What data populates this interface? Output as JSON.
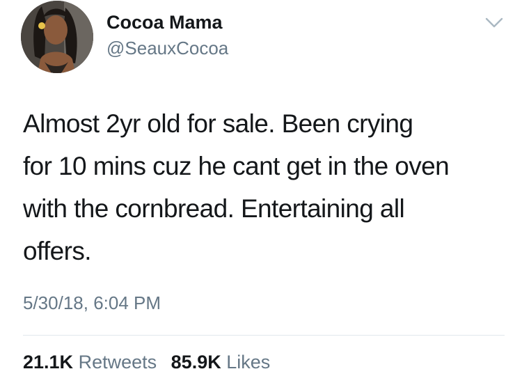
{
  "author": {
    "display_name": "Cocoa Mama",
    "handle": "@SeauxCocoa",
    "avatar_icon": "profile-photo"
  },
  "menu": {
    "icon": "chevron-down-icon"
  },
  "tweet": {
    "lines": [
      "Almost 2yr old for sale.  Been crying",
      "for 10 mins cuz he cant get in the oven",
      "with the cornbread. Entertaining all",
      "offers."
    ],
    "timestamp": "5/30/18, 6:04 PM"
  },
  "stats": {
    "retweets_count": "21.1K",
    "retweets_label": "Retweets",
    "likes_count": "85.9K",
    "likes_label": "Likes"
  },
  "colors": {
    "text_primary": "#14171a",
    "text_secondary": "#657786",
    "divider": "#e1e8ed",
    "background": "#ffffff"
  }
}
